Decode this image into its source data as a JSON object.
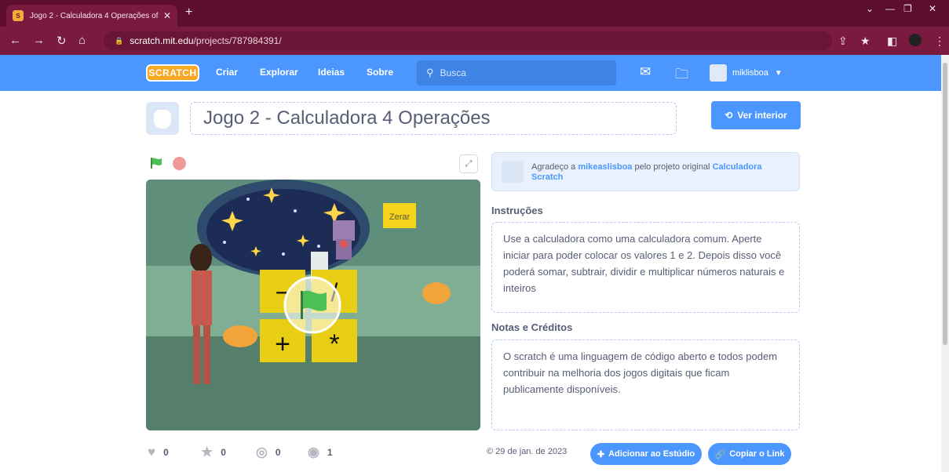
{
  "browser": {
    "tab_title": "Jogo 2 - Calculadora 4 Operações of",
    "tab_close": "✕",
    "new_tab": "+",
    "url_host": "scratch.mit.edu",
    "url_path": "/projects/787984391/"
  },
  "scratch_nav": {
    "logo": "SCRATCH",
    "links": [
      "Criar",
      "Explorar",
      "Ideias",
      "Sobre"
    ],
    "search_placeholder": "Busca",
    "username": "miklisboa"
  },
  "project": {
    "title": "Jogo 2 - Calculadora 4 Operações",
    "see_inside_label": "Ver interior",
    "remix_prefix": "Agradeço a",
    "remix_author": "mikeaslisboa",
    "remix_middle": "pelo projeto original",
    "remix_project": "Calculadora Scratch",
    "instructions_title": "Instruções",
    "instructions_text": "Use a calculadora como uma calculadora comum. Aperte iniciar para poder colocar os valores 1 e 2. Depois disso você poderá somar, subtrair, dividir e multiplicar números naturais e inteiros",
    "notes_title": "Notas e Créditos",
    "notes_text": "O scratch é uma linguagem de código aberto e todos podem contribuir na melhoria dos jogos digitais que ficam publicamente disponíveis."
  },
  "stage": {
    "reset_button": "Zerar",
    "operator_buttons": [
      "−",
      "/",
      "+",
      "*"
    ]
  },
  "stats": {
    "loves": "0",
    "favorites": "0",
    "remixes": "0",
    "views": "1",
    "date": "© 29 de jan. de 2023",
    "add_studio_label": "Adicionar ao Estúdio",
    "copy_link_label": "Copiar o Link"
  },
  "colors": {
    "scratch_blue": "#4c97ff",
    "browser_frame": "#5c0e2c",
    "text": "#575e75"
  }
}
